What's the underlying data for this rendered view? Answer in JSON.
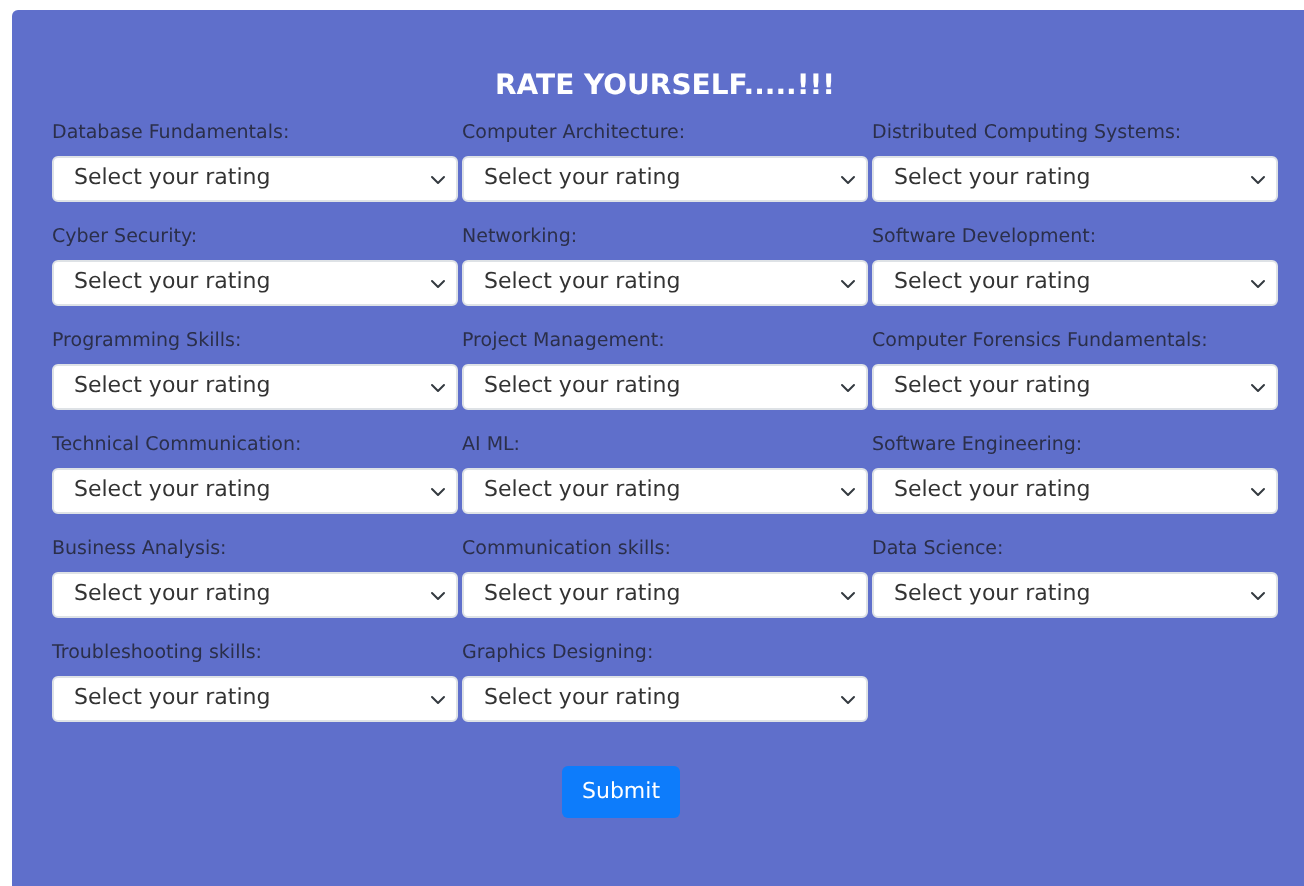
{
  "title": "RATE YOURSELF.....!!!",
  "fields": [
    {
      "label": "Database Fundamentals:",
      "placeholder": "Select your rating"
    },
    {
      "label": "Computer Architecture:",
      "placeholder": "Select your rating"
    },
    {
      "label": "Distributed Computing Systems:",
      "placeholder": "Select your rating"
    },
    {
      "label": "Cyber Security:",
      "placeholder": "Select your rating"
    },
    {
      "label": "Networking:",
      "placeholder": "Select your rating"
    },
    {
      "label": "Software Development:",
      "placeholder": "Select your rating"
    },
    {
      "label": "Programming Skills:",
      "placeholder": "Select your rating"
    },
    {
      "label": "Project Management:",
      "placeholder": "Select your rating"
    },
    {
      "label": "Computer Forensics Fundamentals:",
      "placeholder": "Select your rating"
    },
    {
      "label": "Technical Communication:",
      "placeholder": "Select your rating"
    },
    {
      "label": "AI ML:",
      "placeholder": "Select your rating"
    },
    {
      "label": "Software Engineering:",
      "placeholder": "Select your rating"
    },
    {
      "label": "Business Analysis:",
      "placeholder": "Select your rating"
    },
    {
      "label": "Communication skills:",
      "placeholder": "Select your rating"
    },
    {
      "label": "Data Science:",
      "placeholder": "Select your rating"
    },
    {
      "label": "Troubleshooting skills:",
      "placeholder": "Select your rating"
    },
    {
      "label": "Graphics Designing:",
      "placeholder": "Select your rating"
    }
  ],
  "submit": "Submit"
}
